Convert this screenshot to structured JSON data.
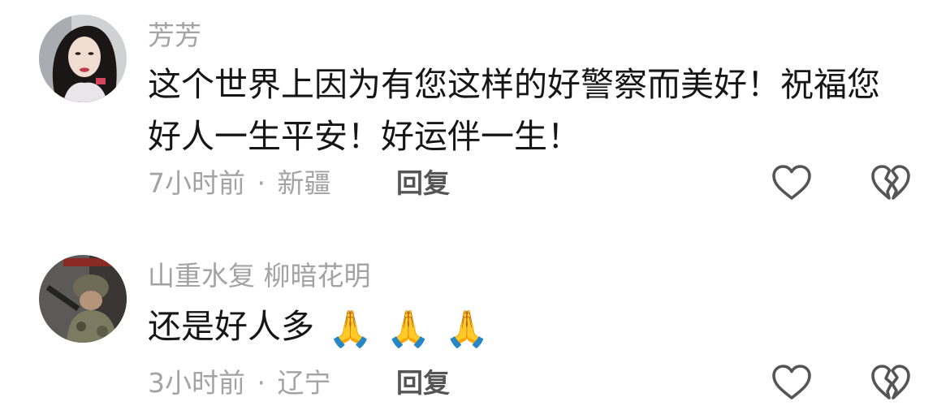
{
  "comments": [
    {
      "author": "芳芳",
      "text": "这个世界上因为有您这样的好警察而美好！祝福您好人一生平安！好运伴一生！",
      "time": "7小时前",
      "location": "新疆",
      "separator": "·",
      "reply_label": "回复",
      "avatar_icon": "woman-portrait-avatar"
    },
    {
      "author": "山重水复 柳暗花明",
      "text": "还是好人多",
      "emojis": [
        "🙏",
        "🙏",
        "🙏"
      ],
      "time": "3小时前",
      "location": "辽宁",
      "separator": "·",
      "reply_label": "回复",
      "avatar_icon": "soldier-photo-avatar"
    }
  ],
  "icons": {
    "like": "heart-outline-icon",
    "dislike": "broken-heart-icon"
  },
  "colors": {
    "author": "#a3a3a3",
    "text": "#161616",
    "meta": "#a3a3a3",
    "reply": "#555555",
    "icon_stroke": "#555555"
  }
}
